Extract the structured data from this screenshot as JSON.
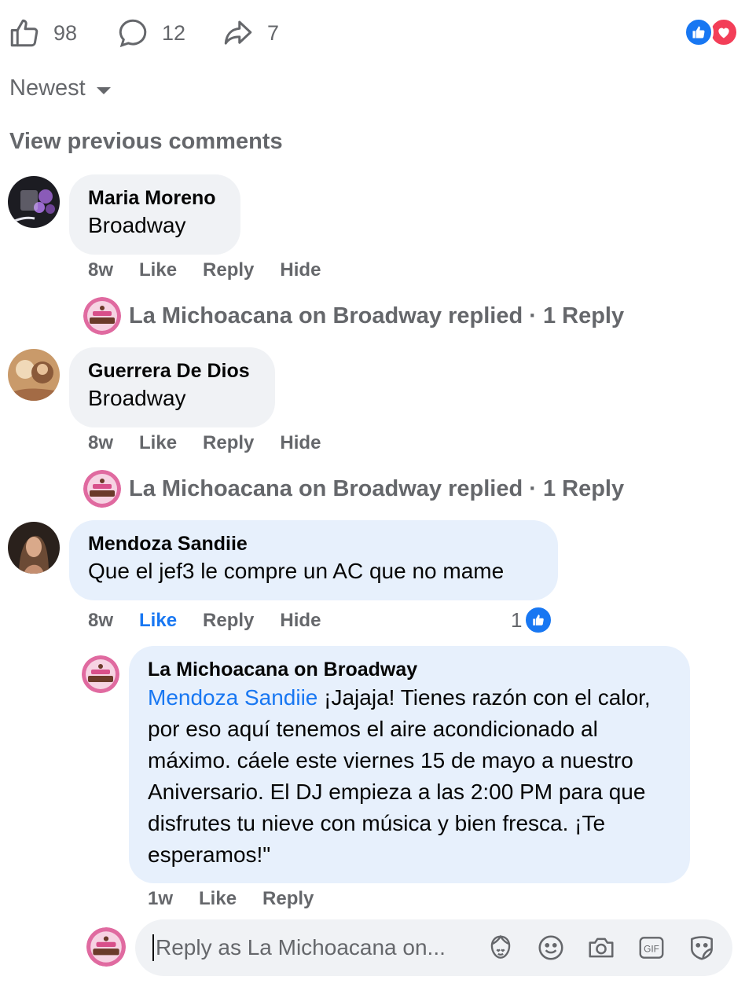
{
  "stats": {
    "likes": "98",
    "comments": "12",
    "shares": "7"
  },
  "reaction_icons": [
    "like-icon",
    "love-icon"
  ],
  "sort": {
    "label": "Newest"
  },
  "view_previous": "View previous comments",
  "comments": [
    {
      "author": "Maria Moreno",
      "text": "Broadway",
      "time": "8w",
      "like_label": "Like",
      "reply_label": "Reply",
      "hide_label": "Hide",
      "replied_summary": "La Michoacana on Broadway replied · 1 Reply"
    },
    {
      "author": "Guerrera De Dios",
      "text": "Broadway",
      "time": "8w",
      "like_label": "Like",
      "reply_label": "Reply",
      "hide_label": "Hide",
      "replied_summary": "La Michoacana on Broadway replied · 1 Reply"
    },
    {
      "author": "Mendoza Sandiie",
      "text": "Que el jef3 le compre un AC que no mame",
      "time": "8w",
      "like_label": "Like",
      "liked": true,
      "reply_label": "Reply",
      "hide_label": "Hide",
      "like_count": "1"
    }
  ],
  "reply": {
    "author": "La Michoacana on Broadway",
    "mention": "Mendoza Sandiie",
    "text": " ¡Jajaja! Tienes razón con el calor, por eso aquí tenemos el aire acondicionado al máximo. cáele este viernes 15 de mayo a nuestro Aniversario. El DJ empieza a las 2:00 PM para que disfrutes tu nieve con música y bien fresca. ¡Te esperamos!\"",
    "time": "1w",
    "like_label": "Like",
    "reply_label": "Reply"
  },
  "composer": {
    "placeholder": "Reply as La Michoacana on...",
    "tool_icons": [
      "avatar-sticker-icon",
      "emoji-icon",
      "camera-icon",
      "gif-icon",
      "sticker-icon"
    ]
  },
  "colors": {
    "accent": "#1877f2",
    "bubble": "#f0f2f5",
    "highlight_bubble": "#e7f0fc",
    "muted": "#65676b",
    "love": "#f33e58"
  }
}
